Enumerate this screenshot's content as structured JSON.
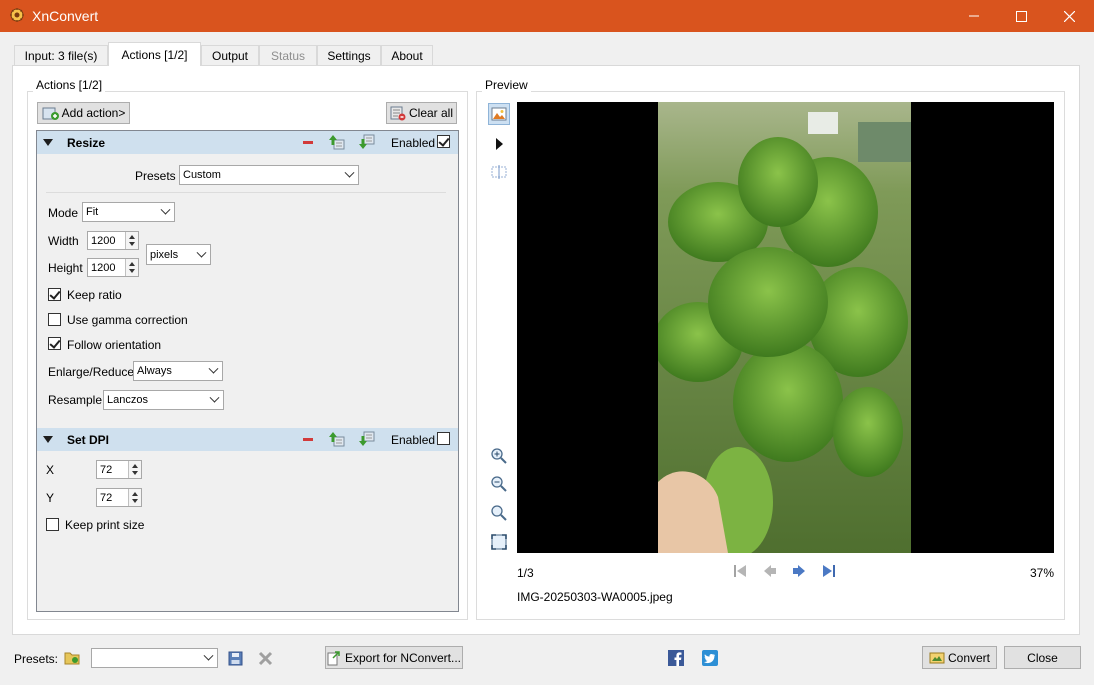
{
  "window": {
    "title": "XnConvert",
    "titlebar_color": "#d9541e"
  },
  "tabs": [
    {
      "label": "Input: 3 file(s)"
    },
    {
      "label": "Actions [1/2]"
    },
    {
      "label": "Output"
    },
    {
      "label": "Status"
    },
    {
      "label": "Settings"
    },
    {
      "label": "About"
    }
  ],
  "actions": {
    "group_label": "Actions [1/2]",
    "add_action_label": "Add action>",
    "clear_all_label": "Clear all",
    "resize": {
      "title": "Resize",
      "enabled_label": "Enabled",
      "enabled": true,
      "presets_label": "Presets",
      "presets_value": "Custom",
      "mode_label": "Mode",
      "mode_value": "Fit",
      "width_label": "Width",
      "width_value": "1200",
      "height_label": "Height",
      "height_value": "1200",
      "unit_value": "pixels",
      "keep_ratio_label": "Keep ratio",
      "keep_ratio": true,
      "gamma_label": "Use gamma correction",
      "gamma": false,
      "follow_orientation_label": "Follow orientation",
      "follow_orientation": true,
      "enlarge_label": "Enlarge/Reduce",
      "enlarge_value": "Always",
      "resample_label": "Resample",
      "resample_value": "Lanczos"
    },
    "dpi": {
      "title": "Set DPI",
      "enabled_label": "Enabled",
      "enabled": false,
      "x_label": "X",
      "x_value": "72",
      "y_label": "Y",
      "y_value": "72",
      "keep_print_label": "Keep print size",
      "keep_print": false
    }
  },
  "preview": {
    "group_label": "Preview",
    "page_counter": "1/3",
    "zoom": "37%",
    "filename": "IMG-20250303-WA0005.jpeg"
  },
  "footer": {
    "presets_label": "Presets:",
    "presets_value": "",
    "export_label": "Export for NConvert...",
    "convert_label": "Convert",
    "close_label": "Close"
  }
}
